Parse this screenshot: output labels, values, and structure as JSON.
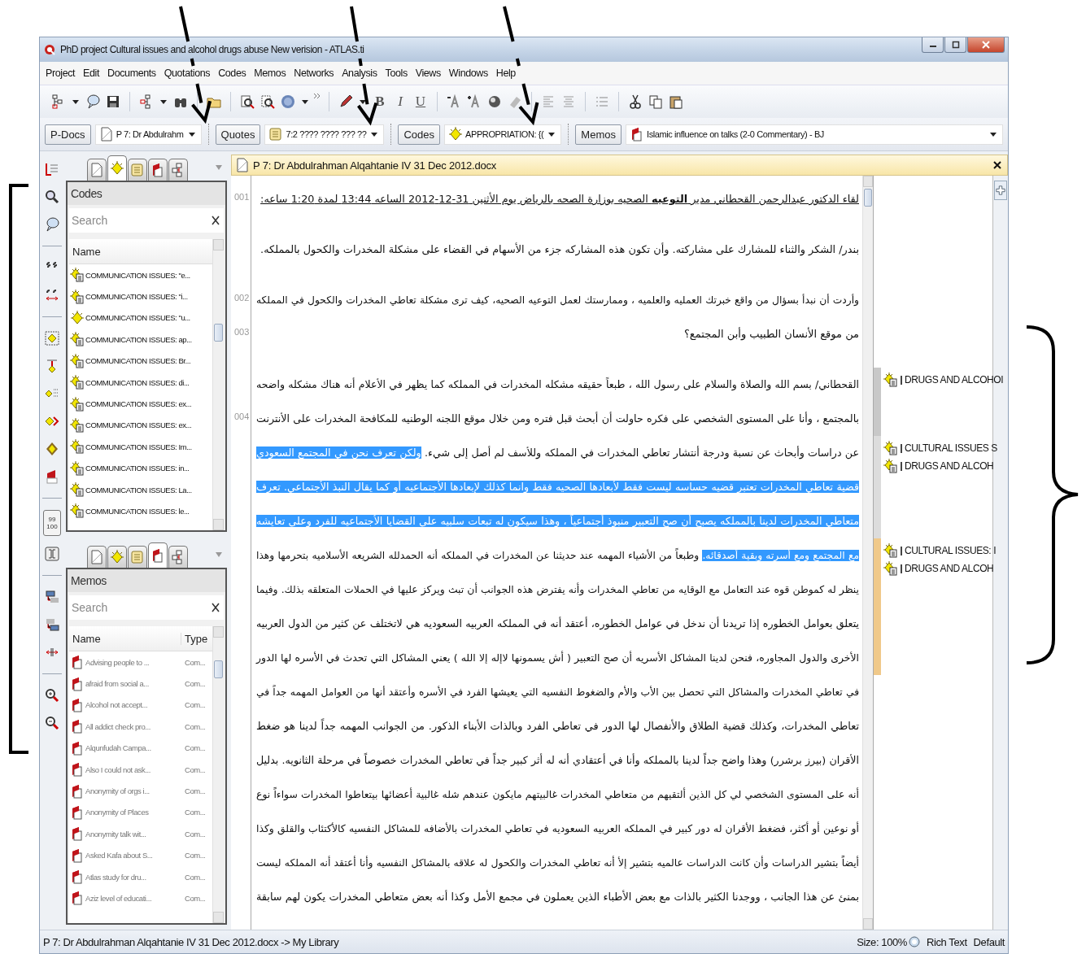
{
  "window": {
    "title": "PhD project Cultural issues and alcohol drugs abuse New verision - ATLAS.ti"
  },
  "menu": [
    "Project",
    "Edit",
    "Documents",
    "Quotations",
    "Codes",
    "Memos",
    "Networks",
    "Analysis",
    "Tools",
    "Views",
    "Windows",
    "Help"
  ],
  "toolbar": {
    "format_buttons": [
      "B",
      "I",
      "U"
    ]
  },
  "selectors": [
    {
      "button": "P-Docs",
      "kind": "document",
      "value": "P 7: Dr Abdulrahm"
    },
    {
      "button": "Quotes",
      "kind": "quotation",
      "value": "7:2 ???? ???? ??? ??"
    },
    {
      "button": "Codes",
      "kind": "code",
      "value": "APPROPRIATION: {("
    },
    {
      "button": "Memos",
      "kind": "memo",
      "value": "Islamic influence on talks (2-0 Commentary) - BJ"
    }
  ],
  "side_strip": {
    "number_toggle": [
      "99",
      "100"
    ]
  },
  "panels": [
    {
      "tabs": [
        {
          "kind": "document",
          "selected": false
        },
        {
          "kind": "code",
          "selected": true
        },
        {
          "kind": "quotation",
          "selected": false
        },
        {
          "kind": "memo",
          "selected": false
        },
        {
          "kind": "network",
          "selected": false
        }
      ],
      "title": "Codes",
      "search": {
        "placeholder": "Search"
      },
      "columns": [
        "Name"
      ],
      "muted": false,
      "rows": [
        {
          "kind": "code-comment",
          "cells": [
            "COMMUNICATION ISSUES: \"e..."
          ]
        },
        {
          "kind": "code-comment",
          "cells": [
            "COMMUNICATION ISSUES: \"i..."
          ]
        },
        {
          "kind": "code",
          "cells": [
            "COMMUNICATION ISSUES: \"u..."
          ]
        },
        {
          "kind": "code-comment",
          "cells": [
            "COMMUNICATION ISSUES: ap..."
          ]
        },
        {
          "kind": "code-comment",
          "cells": [
            "COMMUNICATION ISSUES: Br..."
          ]
        },
        {
          "kind": "code-comment",
          "cells": [
            "COMMUNICATION ISSUES: di..."
          ]
        },
        {
          "kind": "code-comment",
          "cells": [
            "COMMUNICATION ISSUES: ex..."
          ]
        },
        {
          "kind": "code-comment",
          "cells": [
            "COMMUNICATION ISSUES: ex..."
          ]
        },
        {
          "kind": "code-comment",
          "cells": [
            "COMMUNICATION ISSUES: Im..."
          ]
        },
        {
          "kind": "code-comment",
          "cells": [
            "COMMUNICATION ISSUES: in..."
          ]
        },
        {
          "kind": "code-comment",
          "cells": [
            "COMMUNICATION ISSUES: La..."
          ]
        },
        {
          "kind": "code-comment",
          "cells": [
            "COMMUNICATION ISSUES: le..."
          ]
        }
      ]
    },
    {
      "tabs": [
        {
          "kind": "document",
          "selected": false
        },
        {
          "kind": "code",
          "selected": false
        },
        {
          "kind": "quotation",
          "selected": false
        },
        {
          "kind": "memo",
          "selected": true
        },
        {
          "kind": "network",
          "selected": false
        }
      ],
      "title": "Memos",
      "search": {
        "placeholder": "Search"
      },
      "columns": [
        "Name",
        "Type"
      ],
      "muted": true,
      "rows": [
        {
          "kind": "memo",
          "cells": [
            "Advising people to ...",
            "Com..."
          ]
        },
        {
          "kind": "memo",
          "cells": [
            "afraid from social a...",
            "Com..."
          ]
        },
        {
          "kind": "memo",
          "cells": [
            "Alcohol not accept...",
            "Com..."
          ]
        },
        {
          "kind": "memo",
          "cells": [
            "All addict check pro...",
            "Com..."
          ]
        },
        {
          "kind": "memo",
          "cells": [
            "Alqunfudah Campa...",
            "Com..."
          ]
        },
        {
          "kind": "memo",
          "cells": [
            "Also I could not ask...",
            "Com..."
          ]
        },
        {
          "kind": "memo",
          "cells": [
            "Anonymity of orgs i...",
            "Com..."
          ]
        },
        {
          "kind": "memo",
          "cells": [
            "Anonymity of Places",
            "Com..."
          ]
        },
        {
          "kind": "memo",
          "cells": [
            "Anonymity talk wit...",
            "Com..."
          ]
        },
        {
          "kind": "memo",
          "cells": [
            "Asked Kafa about S...",
            "Com..."
          ]
        },
        {
          "kind": "memo",
          "cells": [
            "Atlas study for dru...",
            "Com..."
          ]
        },
        {
          "kind": "memo",
          "cells": [
            "Aziz level of educati...",
            "Com..."
          ]
        }
      ]
    }
  ],
  "document": {
    "title": "P 7: Dr Abdulrahman Alqahtanie IV 31 Dec 2012.docx",
    "paragraphs": [
      {
        "continues": false,
        "lines": [
          {
            "number": "001",
            "underlined": true,
            "segments": [
              {
                "text": "لقاء الدكتور عبدالرحمن القحطاني مدير **التوعيه** الصحيه بوزارة الصحه بالرياض يوم الأثنين 31-12-2012 الساعه 13:44 لمدة 1:20 ساعه:",
                "selected": false
              }
            ]
          }
        ]
      },
      {
        "continues": false,
        "lines": [
          {
            "underlined": false,
            "segments": [
              {
                "text": "بندر/ الشكر والثناء للمشارك على مشاركته. وأن تكون هذه المشاركه جزء من الأسهام في القضاء على مشكلة المخدرات والكحول بالمملكه.",
                "selected": false
              }
            ]
          }
        ]
      },
      {
        "continues": false,
        "lines": [
          {
            "number": "002",
            "underlined": false,
            "segments": [
              {
                "text": "وأردت أن نبدأ بسؤال من واقع خبرتك العمليه والعلميه ، وممارستك لعمل التوعيه الصحيه، كيف ترى مشكلة تعاطي المخدرات والكحول في المملكه",
                "selected": false
              }
            ]
          },
          {
            "number": "003",
            "underlined": false,
            "segments": [
              {
                "text": "من موقع الأنسان الطبيب وأبن المجتمع؟",
                "selected": false
              }
            ]
          }
        ]
      },
      {
        "continues": true,
        "lines": [
          {
            "underlined": false,
            "quotation_bar": {
              "color": "#c8c8c8"
            },
            "codes": [
              "DRUGS AND ALCOHOI"
            ],
            "segments": [
              {
                "text": "القحطاني/ بسم الله والصلاة والسلام على رسول الله ، طبعاً حقيقه مشكله المخدرات في المملكه كما يظهر في الأعلام أنه هناك مشكله  واضحه",
                "selected": false
              }
            ]
          },
          {
            "number": "004",
            "underlined": false,
            "quotation_bar": {
              "color": "#c8c8c8"
            },
            "segments": [
              {
                "text": "بالمجتمع ، وأنا على المستوى الشخصي على فكره حاولت أن أبحث قبل فتره ومن خلال موقع اللجنه الوطنيه للمكافحة المخدرات على الأنترنت",
                "selected": false
              }
            ]
          },
          {
            "underlined": false,
            "quotation_bar": {
              "color": "#dcdcdc"
            },
            "codes": [
              "CULTURAL ISSUES S",
              "DRUGS AND ALCOH"
            ],
            "segments": [
              {
                "text": "عن دراسات وأبحاث عن نسبة ودرجة أنتشار تعاطي المخدرات في المملكه وللأسف لم أصل إلى شيء. ",
                "selected": false
              },
              {
                "text": "ولكن تعرف نحن في المجتمع السعودي",
                "selected": true
              }
            ]
          },
          {
            "underlined": false,
            "quotation_bar": {
              "color": "#dcdcdc"
            },
            "segments": [
              {
                "text": "قضية تعاطي المخدرات تعتبر قضيه حساسه ليست فقط لأبعادها الصحيه فقط وانما كذلك لإبعادها الأجتماعيه أو كما يقال النبذ الأجتماعي. تعرف",
                "selected": true
              }
            ]
          },
          {
            "underlined": false,
            "quotation_bar": {
              "color": "#dcdcdc"
            },
            "segments": [
              {
                "text": "متعاطي المخدرات لدينا بالمملكه يصبح أن صح التعبير منبوذ أجتماعياً ، وهذا سيكون له تبعات سلبيه على القضايا الأجتماعيه للفرد وعلى تعايشه",
                "selected": true
              }
            ]
          },
          {
            "underlined": false,
            "quotation_bar": {
              "color": "#f0c98a"
            },
            "codes": [
              "CULTURAL ISSUES: I",
              "DRUGS AND ALCOH"
            ],
            "segments": [
              {
                "text": "مع المجتمع ومع أسرته وبقية أصدقائه.",
                "selected": true
              },
              {
                "text": " وطبعاً من الأشياء المهمه عند حديثنا عن المخدرات في المملكه أنه الحمدلله الشريعه الأسلاميه بتحرمها وهذا",
                "selected": false
              }
            ]
          },
          {
            "underlined": false,
            "quotation_bar": {
              "color": "#f0c98a"
            },
            "segments": [
              {
                "text": "ينظر له كموطن قوه عند التعامل مع الوقايه من تعاطي المخدرات وأنه يفترض هذه الجوانب أن تبث ويركز عليها في الحملات المتعلقه بذلك. وفيما",
                "selected": false
              }
            ]
          },
          {
            "underlined": false,
            "quotation_bar": {
              "color": "#f0c98a"
            },
            "segments": [
              {
                "text": "يتعلق بعوامل الخطوره إذا تريدنا أن ندخل في عوامل الخطوره، أعتقد أنه في المملكه العربيه السعوديه هي لاتختلف عن كثير من الدول العربيه",
                "selected": false
              }
            ]
          },
          {
            "underlined": false,
            "quotation_bar": {
              "color": "#f0c98a"
            },
            "segments": [
              {
                "text": "الأخرى والدول المجاوره، فنحن لدينا المشاكل الأسريه أن صح التعبير ( أش يسمونها لاإله إلا الله ) يعني المشاكل التي تحدث في الأسره لها الدور",
                "selected": false
              }
            ]
          },
          {
            "underlined": false,
            "segments": [
              {
                "text": "في تعاطي المخدرات والمشاكل التي تحصل بين الأب والأم والضغوط النفسيه التي يعيشها الفرد في الأسره وأعتقد أنها من العوامل المهمه جداً في",
                "selected": false
              }
            ]
          },
          {
            "underlined": false,
            "segments": [
              {
                "text": "تعاطي المخدرات، وكذلك قضية الطلاق والأنفصال لها الدور في تعاطي الفرد وبالذات الأبناء الذكور. من الجوانب المهمه جداً لدينا هو ضغط",
                "selected": false
              }
            ]
          },
          {
            "underlined": false,
            "segments": [
              {
                "text": "الأقران (بيرز برشرر) وهذا واضح جداً لدينا بالمملكه وأنا في أعتقادي أنه له أثر كبير جداً في تعاطي المخدرات خصوصاً في مرحلة الثانويه. بدليل",
                "selected": false
              }
            ]
          },
          {
            "underlined": false,
            "segments": [
              {
                "text": "أنه على المستوى الشخصي لي كل الذين ألتقيهم من متعاطي المخدرات غالبيتهم مايكون عندهم شله غالبية أعضائها بيتعاطوا المخدرات سواءاً نوع",
                "selected": false
              }
            ]
          },
          {
            "underlined": false,
            "segments": [
              {
                "text": "أو نوعين أو أكثر، فضغط الأقران له دور كبير في المملكه العربيه السعوديه في تعاطي المخدرات بالأضافه للمشاكل النفسيه كالأكتئاب والقلق وكذا",
                "selected": false
              }
            ]
          },
          {
            "underlined": false,
            "segments": [
              {
                "text": "أيضاً بتشير الدراسات وأن كانت الدراسات عالميه بتشير إلأ أنه تعاطي المخدرات والكحول له علاقه بالمشاكل النفسيه وأنا أعتقد أنه المملكه ليست",
                "selected": false
              }
            ]
          },
          {
            "underlined": false,
            "segments": [
              {
                "text": "بمنئ عن هذا الجانب ، ووجدنا الكثير بالذات مع بعض الأطباء الذين يعملون في مجمع الأمل وكذا أنه بعض متعاطي المخدرات يكون لهم سابقة",
                "selected": false
              }
            ]
          }
        ]
      }
    ]
  },
  "status_bar": {
    "path": "P 7: Dr Abdulrahman Alqahtanie IV 31 Dec 2012.docx -> My Library",
    "size": "Size: 100%",
    "format": "Rich Text",
    "style": "Default"
  }
}
